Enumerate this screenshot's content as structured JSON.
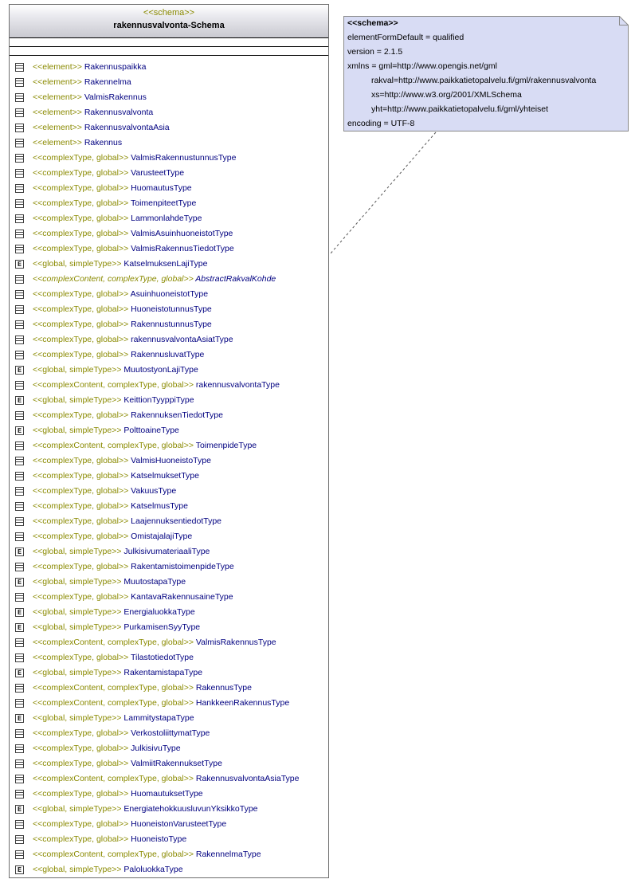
{
  "schema": {
    "stereotype": "<<schema>>",
    "name": "rakennusvalvonta-Schema",
    "items": [
      {
        "st": "<<element>> ",
        "name": "Rakennuspaikka",
        "icon": "element"
      },
      {
        "st": "<<element>> ",
        "name": "Rakennelma",
        "icon": "element"
      },
      {
        "st": "<<element>> ",
        "name": "ValmisRakennus",
        "icon": "element"
      },
      {
        "st": "<<element>> ",
        "name": "Rakennusvalvonta",
        "icon": "element"
      },
      {
        "st": "<<element>> ",
        "name": "RakennusvalvontaAsia",
        "icon": "element"
      },
      {
        "st": "<<element>> ",
        "name": "Rakennus",
        "icon": "element"
      },
      {
        "st": "<<complexType, global>> ",
        "name": "ValmisRakennustunnusType",
        "icon": "element"
      },
      {
        "st": "<<complexType, global>> ",
        "name": "VarusteetType",
        "icon": "element"
      },
      {
        "st": "<<complexType, global>> ",
        "name": "HuomautusType",
        "icon": "element"
      },
      {
        "st": "<<complexType, global>> ",
        "name": "ToimenpiteetType",
        "icon": "element"
      },
      {
        "st": "<<complexType, global>> ",
        "name": "LammonlahdeType",
        "icon": "element"
      },
      {
        "st": "<<complexType, global>> ",
        "name": "ValmisAsuinhuoneistotType",
        "icon": "element"
      },
      {
        "st": "<<complexType, global>> ",
        "name": "ValmisRakennusTiedotType",
        "icon": "element"
      },
      {
        "st": "<<global, simpleType>> ",
        "name": "KatselmuksenLajiType",
        "icon": "enum"
      },
      {
        "st": "<<complexContent, complexType, global>> ",
        "name": "AbstractRakvalKohde",
        "icon": "element",
        "abstract": true
      },
      {
        "st": "<<complexType, global>> ",
        "name": "AsuinhuoneistotType",
        "icon": "element"
      },
      {
        "st": "<<complexType, global>> ",
        "name": "HuoneistotunnusType",
        "icon": "element"
      },
      {
        "st": "<<complexType, global>> ",
        "name": "RakennustunnusType",
        "icon": "element"
      },
      {
        "st": "<<complexType, global>> ",
        "name": "rakennusvalvontaAsiatType",
        "icon": "element"
      },
      {
        "st": "<<complexType, global>> ",
        "name": "RakennusluvatType",
        "icon": "element"
      },
      {
        "st": "<<global, simpleType>> ",
        "name": "MuutostyonLajiType",
        "icon": "enum"
      },
      {
        "st": "<<complexContent, complexType, global>> ",
        "name": "rakennusvalvontaType",
        "icon": "element"
      },
      {
        "st": "<<global, simpleType>> ",
        "name": "KeittionTyyppiType",
        "icon": "enum"
      },
      {
        "st": "<<complexType, global>> ",
        "name": "RakennuksenTiedotType",
        "icon": "element"
      },
      {
        "st": "<<global, simpleType>> ",
        "name": "PolttoaineType",
        "icon": "enum"
      },
      {
        "st": "<<complexContent, complexType, global>> ",
        "name": "ToimenpideType",
        "icon": "element"
      },
      {
        "st": "<<complexType, global>> ",
        "name": "ValmisHuoneistoType",
        "icon": "element"
      },
      {
        "st": "<<complexType, global>> ",
        "name": "KatselmuksetType",
        "icon": "element"
      },
      {
        "st": "<<complexType, global>> ",
        "name": "VakuusType",
        "icon": "element"
      },
      {
        "st": "<<complexType, global>> ",
        "name": "KatselmusType",
        "icon": "element"
      },
      {
        "st": "<<complexType, global>> ",
        "name": "LaajennuksentiedotType",
        "icon": "element"
      },
      {
        "st": "<<complexType, global>> ",
        "name": "OmistajalajiType",
        "icon": "element"
      },
      {
        "st": "<<global, simpleType>> ",
        "name": "JulkisivumateriaaliType",
        "icon": "enum"
      },
      {
        "st": "<<complexType, global>> ",
        "name": "RakentamistoimenpideType",
        "icon": "element"
      },
      {
        "st": "<<global, simpleType>> ",
        "name": "MuutostapaType",
        "icon": "enum"
      },
      {
        "st": "<<complexType, global>> ",
        "name": "KantavaRakennusaineType",
        "icon": "element"
      },
      {
        "st": "<<global, simpleType>> ",
        "name": "EnergialuokkaType",
        "icon": "enum"
      },
      {
        "st": "<<global, simpleType>> ",
        "name": "PurkamisenSyyType",
        "icon": "enum"
      },
      {
        "st": "<<complexContent, complexType, global>> ",
        "name": "ValmisRakennusType",
        "icon": "element"
      },
      {
        "st": "<<complexType, global>> ",
        "name": "TilastotiedotType",
        "icon": "element"
      },
      {
        "st": "<<global, simpleType>> ",
        "name": "RakentamistapaType",
        "icon": "enum"
      },
      {
        "st": "<<complexContent, complexType, global>> ",
        "name": "RakennusType",
        "icon": "element"
      },
      {
        "st": "<<complexContent, complexType, global>> ",
        "name": "HankkeenRakennusType",
        "icon": "element"
      },
      {
        "st": "<<global, simpleType>> ",
        "name": "LammitystapaType",
        "icon": "enum"
      },
      {
        "st": "<<complexType, global>> ",
        "name": "VerkostoliittymatType",
        "icon": "element"
      },
      {
        "st": "<<complexType, global>> ",
        "name": "JulkisivuType",
        "icon": "element"
      },
      {
        "st": "<<complexType, global>> ",
        "name": "ValmiitRakennuksetType",
        "icon": "element"
      },
      {
        "st": "<<complexContent, complexType, global>> ",
        "name": "RakennusvalvontaAsiaType",
        "icon": "element"
      },
      {
        "st": "<<complexType, global>> ",
        "name": "HuomautuksetType",
        "icon": "element"
      },
      {
        "st": "<<global, simpleType>> ",
        "name": "EnergiatehokkuusluvunYksikkoType",
        "icon": "enum"
      },
      {
        "st": "<<complexType, global>> ",
        "name": "HuoneistonVarusteetType",
        "icon": "element"
      },
      {
        "st": "<<complexType, global>> ",
        "name": "HuoneistoType",
        "icon": "element"
      },
      {
        "st": "<<complexContent, complexType, global>> ",
        "name": "RakennelmaType",
        "icon": "element"
      },
      {
        "st": "<<global, simpleType>> ",
        "name": "PaloluokkaType",
        "icon": "enum"
      }
    ]
  },
  "note": {
    "lines": [
      "<<schema>>",
      "elementFormDefault = qualified",
      "version = 2.1.5",
      "xmlns = gml=http://www.opengis.net/gml",
      "rakval=http://www.paikkatietopalvelu.fi/gml/rakennusvalvonta",
      "xs=http://www.w3.org/2001/XMLSchema",
      "yht=http://www.paikkatietopalvelu.fi/gml/yhteiset",
      "encoding = UTF-8"
    ],
    "fill": "#d8dcf4",
    "border": "#8a8a8a"
  },
  "colors": {
    "stereotype": "#8a8a00",
    "name": "#000080"
  }
}
